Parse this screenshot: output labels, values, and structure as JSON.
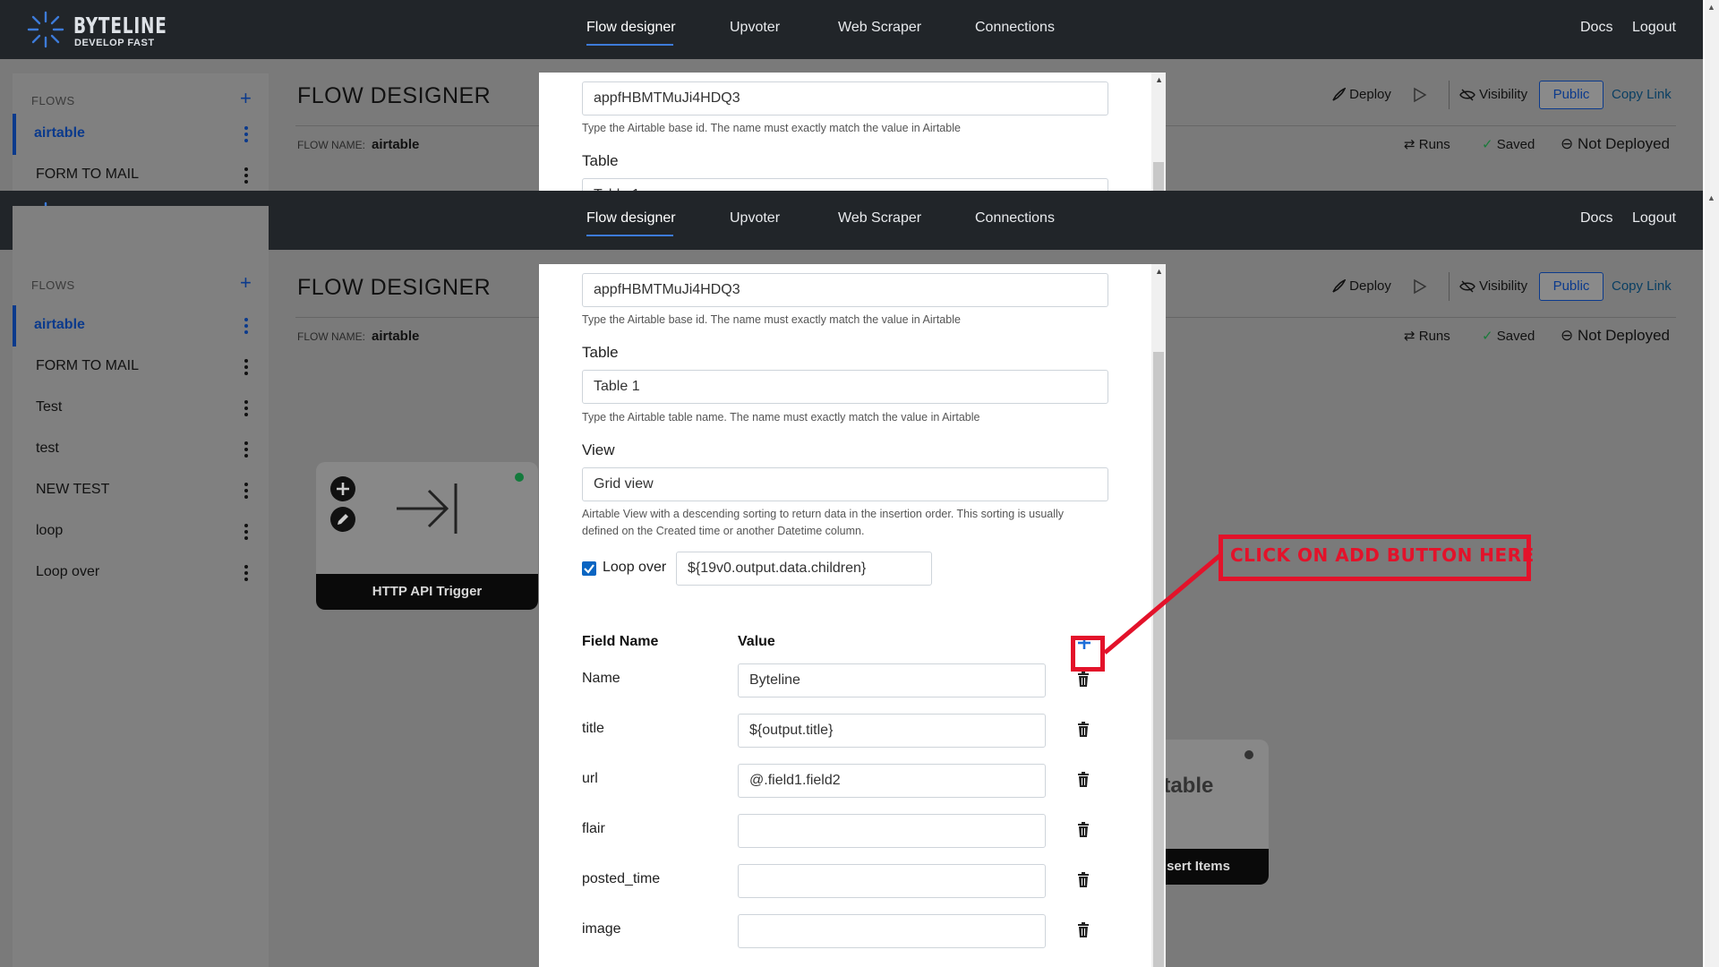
{
  "brand": {
    "name": "BYTELINE",
    "tagline": "DEVELOP FAST"
  },
  "nav": {
    "items": [
      {
        "label": "Flow designer",
        "active": true
      },
      {
        "label": "Upvoter"
      },
      {
        "label": "Web Scraper"
      },
      {
        "label": "Connections"
      }
    ],
    "right": [
      {
        "label": "Docs"
      },
      {
        "label": "Logout"
      }
    ]
  },
  "sidebar": {
    "header": "FLOWS",
    "items": [
      {
        "label": "airtable",
        "active": true
      },
      {
        "label": "FORM TO MAIL"
      },
      {
        "label": "Test"
      },
      {
        "label": "test"
      },
      {
        "label": "NEW TEST"
      },
      {
        "label": "loop"
      },
      {
        "label": "Loop over"
      }
    ]
  },
  "page": {
    "title": "FLOW DESIGNER",
    "flow_name_label": "FLOW NAME:",
    "flow_name": "airtable"
  },
  "toolbar": {
    "deploy": "Deploy",
    "visibility": "Visibility",
    "public": "Public",
    "copy_link": "Copy Link",
    "runs": "Runs",
    "saved": "Saved",
    "not_deployed": "Not Deployed"
  },
  "nodes": {
    "trigger_label": "HTTP API Trigger",
    "airtable_brand": "rtable",
    "airtable_label": "sert Items"
  },
  "modal": {
    "base_id_value": "appfHBMTMuJi4HDQ3",
    "base_id_help": "Type the Airtable base id. The name must exactly match the value in Airtable",
    "table_label": "Table",
    "table_value": "Table 1",
    "table_help": "Type the Airtable table name. The name must exactly match the value in Airtable",
    "view_label": "View",
    "view_value": "Grid view",
    "view_help_1": "Airtable View with a descending sorting to return data in the insertion order. This sorting is usually",
    "view_help_2": "defined on the Created time or another Datetime column.",
    "loop_label": "Loop over",
    "loop_checked": true,
    "loop_value": "${19v0.output.data.children}",
    "field_name_header": "Field Name",
    "value_header": "Value",
    "fields": [
      {
        "name": "Name",
        "value": "Byteline"
      },
      {
        "name": "title",
        "value": "${output.title}"
      },
      {
        "name": "url",
        "value": "@.field1.field2"
      },
      {
        "name": "flair",
        "value": ""
      },
      {
        "name": "posted_time",
        "value": ""
      },
      {
        "name": "image",
        "value": ""
      }
    ]
  },
  "annotation": {
    "text": "CLICK ON ADD BUTTON HERE",
    "color": "#e3122a"
  },
  "colors": {
    "navbar": "#212529",
    "accent": "#0b3a8c",
    "modal_accent": "#1e6fd9",
    "annotation": "#e3122a",
    "status_green": "#1faa59"
  }
}
